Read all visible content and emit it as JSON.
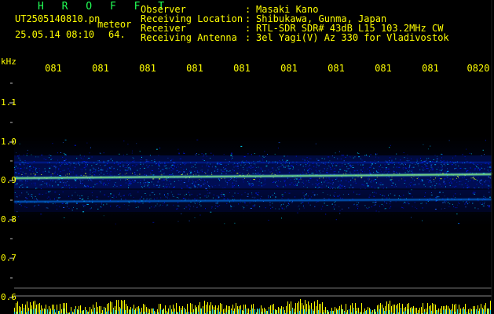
{
  "header": {
    "brand": "H R O F F T",
    "filename": "UT2505140810.pn",
    "meteor_label": "meteor",
    "datetime": "25.05.14 08:10",
    "count": "64."
  },
  "station": {
    "rows": [
      {
        "label": "Observer",
        "value": "Masaki Kano"
      },
      {
        "label": "Receiving Location",
        "value": "Shibukawa, Gunma, Japan"
      },
      {
        "label": "Receiver",
        "value": "RTL-SDR SDR# 43dB L15 103.2MHz CW"
      },
      {
        "label": "Receiving Antenna",
        "value": "3el Yagi(V) Az 330 for Vladivostok"
      }
    ],
    "separator": ":"
  },
  "spectrogram": {
    "frequency_unit": "kHz",
    "frequency_labels": [
      "1.1",
      "1.0",
      "0.9",
      "0.8",
      "0.7",
      "0.6"
    ],
    "time_labels": [
      "081",
      "081",
      "081",
      "081",
      "081",
      "081",
      "081",
      "081",
      "081",
      "0820"
    ],
    "colors": {
      "background": "#000000",
      "label": "#ffff00",
      "brand": "#22ff55",
      "scale": "#c8c8c8",
      "signal_low": "#0019ff",
      "signal_mid": "#00b6ff",
      "signal_high": "#d4ff18",
      "amplitude": "#ffff00",
      "amplitude_secondary": "#00d8ff"
    }
  }
}
